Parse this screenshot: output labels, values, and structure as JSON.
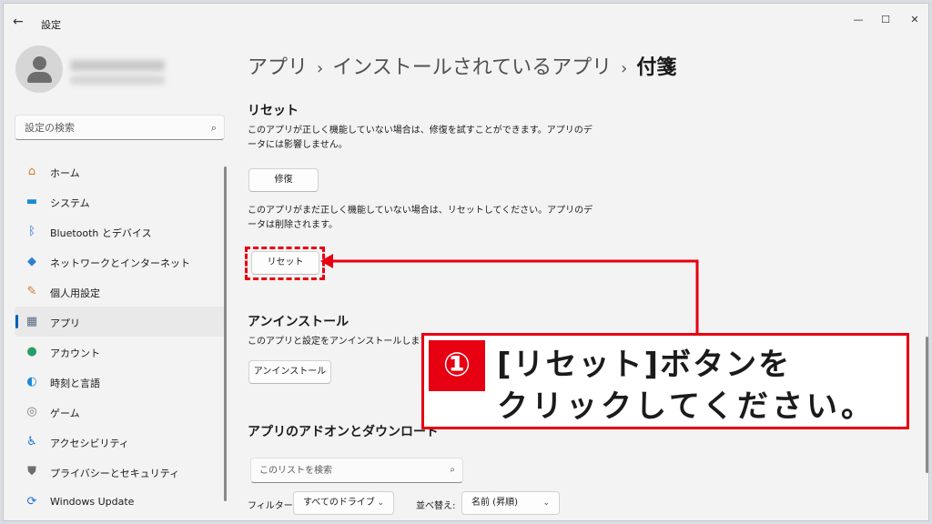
{
  "window": {
    "title": "設定",
    "back_glyph": "←",
    "minimize_glyph": "—",
    "maximize_glyph": "☐",
    "close_glyph": "✕"
  },
  "sidebar": {
    "search_placeholder": "設定の検索",
    "items": [
      {
        "label": "ホーム",
        "icon": "home-icon",
        "glyph": "⌂",
        "color": "#d97a2b"
      },
      {
        "label": "システム",
        "icon": "system-icon",
        "glyph": "▬",
        "color": "#1a8ad4"
      },
      {
        "label": "Bluetooth とデバイス",
        "icon": "bluetooth-icon",
        "glyph": "ᛒ",
        "color": "#1a6fd4"
      },
      {
        "label": "ネットワークとインターネット",
        "icon": "network-icon",
        "glyph": "◆",
        "color": "#2e7fd6"
      },
      {
        "label": "個人用設定",
        "icon": "brush-icon",
        "glyph": "✎",
        "color": "#c47a3a"
      },
      {
        "label": "アプリ",
        "icon": "apps-icon",
        "glyph": "▦",
        "color": "#5b6b82",
        "active": true
      },
      {
        "label": "アカウント",
        "icon": "account-icon",
        "glyph": "●",
        "color": "#2a9c6a"
      },
      {
        "label": "時刻と言語",
        "icon": "time-language-icon",
        "glyph": "◐",
        "color": "#1a8ad4"
      },
      {
        "label": "ゲーム",
        "icon": "game-icon",
        "glyph": "◎",
        "color": "#7a7a7a"
      },
      {
        "label": "アクセシビリティ",
        "icon": "accessibility-icon",
        "glyph": "♿",
        "color": "#1a6fd4"
      },
      {
        "label": "プライバシーとセキュリティ",
        "icon": "shield-icon",
        "glyph": "⛊",
        "color": "#6d6d6d"
      },
      {
        "label": "Windows Update",
        "icon": "update-icon",
        "glyph": "⟳",
        "color": "#1a6fd4"
      }
    ]
  },
  "breadcrumb": {
    "items": [
      "アプリ",
      "インストールされているアプリ"
    ],
    "separator": "›",
    "current": "付箋"
  },
  "reset_section": {
    "title": "リセット",
    "repair_desc": "このアプリが正しく機能していない場合は、修復を試すことができます。アプリのデータには影響しません。",
    "repair_button": "修復",
    "reset_desc": "このアプリがまだ正しく機能していない場合は、リセットしてください。アプリのデータは削除されます。",
    "reset_button": "リセット"
  },
  "uninstall_section": {
    "title": "アンインストール",
    "desc": "このアプリと設定をアンインストールします。ト",
    "button": "アンインストール"
  },
  "addons_section": {
    "title": "アプリのアドオンとダウンロード",
    "search_placeholder": "このリストを検索",
    "filter_label": "フィルター:",
    "filter_value": "すべてのドライブ",
    "sort_label": "並べ替え:",
    "sort_value": "名前 (昇順)"
  },
  "callout": {
    "number": "①",
    "line1": "[リセット]ボタンを",
    "line2": "クリックしてください。",
    "accent": "#e60012"
  }
}
